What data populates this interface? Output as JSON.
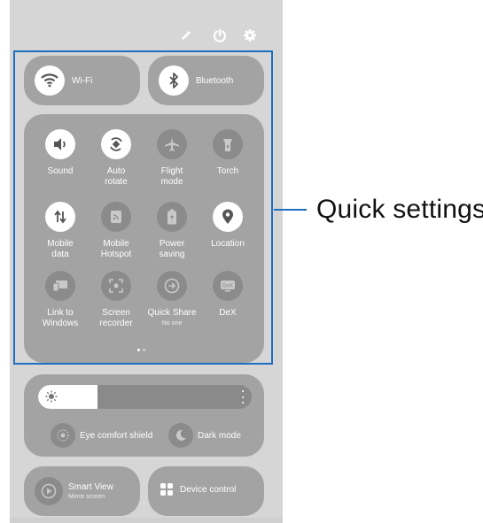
{
  "header": {
    "edit_icon": "pencil-icon",
    "power_icon": "power-icon",
    "settings_icon": "gear-icon"
  },
  "top_tiles": [
    {
      "label": "Wi-Fi",
      "icon": "wifi-icon",
      "state": "on"
    },
    {
      "label": "Bluetooth",
      "icon": "bluetooth-icon",
      "state": "on"
    }
  ],
  "quick_tiles": [
    {
      "label": "Sound",
      "icon": "sound-icon",
      "state": "on"
    },
    {
      "label": "Auto\nrotate",
      "icon": "auto-rotate-icon",
      "state": "on"
    },
    {
      "label": "Flight\nmode",
      "icon": "airplane-icon",
      "state": "off"
    },
    {
      "label": "Torch",
      "icon": "torch-icon",
      "state": "off"
    },
    {
      "label": "Mobile\ndata",
      "icon": "mobile-data-icon",
      "state": "on"
    },
    {
      "label": "Mobile\nHotspot",
      "icon": "hotspot-icon",
      "state": "off"
    },
    {
      "label": "Power\nsaving",
      "icon": "battery-icon",
      "state": "off"
    },
    {
      "label": "Location",
      "icon": "location-icon",
      "state": "on"
    },
    {
      "label": "Link to\nWindows",
      "icon": "link-to-windows-icon",
      "state": "off"
    },
    {
      "label": "Screen\nrecorder",
      "icon": "screen-recorder-icon",
      "state": "off"
    },
    {
      "label": "Quick Share",
      "sub": "No one",
      "icon": "quick-share-icon",
      "state": "off"
    },
    {
      "label": "DeX",
      "icon": "dex-icon",
      "state": "off"
    }
  ],
  "pagination": {
    "pages": 2,
    "current": 1
  },
  "brightness": {
    "level": 0.28,
    "icon": "sun-icon"
  },
  "display_toggles": [
    {
      "label": "Eye comfort shield",
      "icon": "eye-comfort-icon"
    },
    {
      "label": "Dark mode",
      "icon": "moon-icon"
    }
  ],
  "bottom_tiles": {
    "smart_view": {
      "label": "Smart View",
      "sub": "Mirror screen",
      "icon": "smart-view-icon"
    },
    "device_control": {
      "label": "Device control",
      "icon": "grid-icon"
    }
  },
  "callout": {
    "label": "Quick settings",
    "color": "#1e6fbf"
  }
}
